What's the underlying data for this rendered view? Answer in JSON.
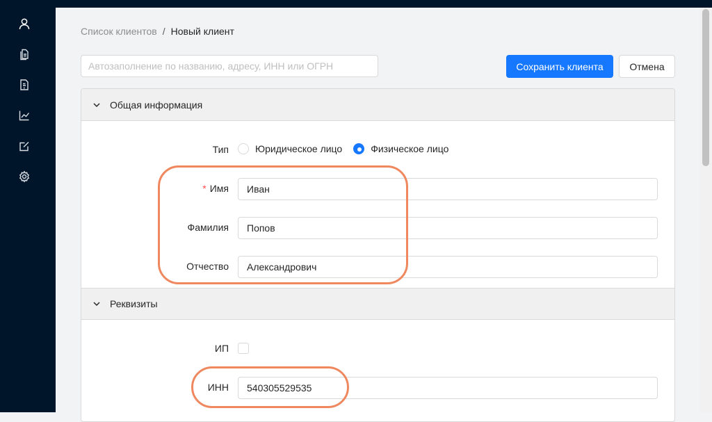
{
  "sidebar": {
    "items": [
      {
        "icon": "user-icon"
      },
      {
        "icon": "documents-icon"
      },
      {
        "icon": "invoice-icon"
      },
      {
        "icon": "chart-icon"
      },
      {
        "icon": "edit-icon"
      },
      {
        "icon": "settings-icon"
      }
    ]
  },
  "breadcrumb": {
    "parent": "Список клиентов",
    "separator": "/",
    "current": "Новый клиент"
  },
  "autofill": {
    "placeholder": "Автозаполнение по названию, адресу, ИНН или ОГРН",
    "value": ""
  },
  "actions": {
    "save_label": "Сохранить клиента",
    "cancel_label": "Отмена"
  },
  "general_section": {
    "title": "Общая информация",
    "type_label": "Тип",
    "type_options": [
      "Юридическое лицо",
      "Физическое лицо"
    ],
    "type_selected": "Физическое лицо",
    "first_name_label": "Имя",
    "first_name_required_mark": "*",
    "first_name_value": "Иван",
    "last_name_label": "Фамилия",
    "last_name_value": "Попов",
    "patronymic_label": "Отчество",
    "patronymic_value": "Александрович"
  },
  "requisites_section": {
    "title": "Реквизиты",
    "ip_label": "ИП",
    "ip_checked": false,
    "inn_label": "ИНН",
    "inn_value": "540305529535"
  },
  "colors": {
    "sidebar": "#001529",
    "primary": "#1677ff",
    "highlight": "#f0885f",
    "required": "#ff4d4f"
  }
}
